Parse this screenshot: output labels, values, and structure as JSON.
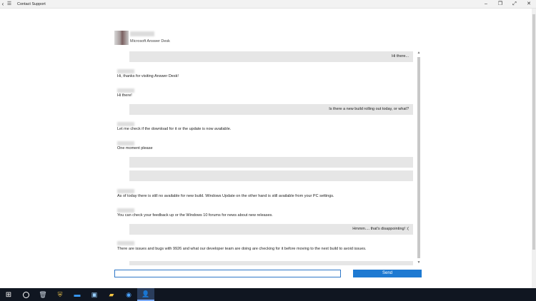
{
  "window": {
    "title": "Contact Support",
    "back_icon": "back-arrow-icon",
    "menu_icon": "hamburger-icon",
    "controls": [
      "minimize-icon",
      "restore-icon",
      "fullscreen-icon",
      "close-icon"
    ]
  },
  "header": {
    "subtitle": "Microsoft Answer Desk"
  },
  "messages": [
    {
      "from": "user",
      "text": "Hi there..."
    },
    {
      "from": "agent",
      "text": "Hi, thanks for visiting Answer Desk!"
    },
    {
      "from": "agent",
      "text": "Hi there!"
    },
    {
      "from": "user",
      "text": "Is there a new build rolling out today, or what?"
    },
    {
      "from": "agent",
      "text": "Let me check if the download for it or the update is now available."
    },
    {
      "from": "agent",
      "text": "One moment please"
    },
    {
      "from": "user",
      "text": ""
    },
    {
      "from": "user",
      "text": ""
    },
    {
      "from": "agent",
      "text": "As of today there is still no available for new build. Windows Update on the other hand is still available from your PC settings."
    },
    {
      "from": "agent",
      "text": "You can check your feedback up or the Windows 10 forums for news about new releases."
    },
    {
      "from": "user",
      "text": "Hmmm.... that's disappointing! :("
    },
    {
      "from": "agent",
      "text": "There are issues and bugs with 9926 and what our developer team are doing are checking for it before moving to the next build to avoid issues."
    }
  ],
  "composer": {
    "value": "",
    "send_label": "Send"
  },
  "taskbar": {
    "icons": [
      "windows-start-icon",
      "cortana-search-icon",
      "recycle-bin-icon",
      "windows-defender-icon",
      "messaging-icon",
      "remote-desktop-icon",
      "file-explorer-icon",
      "browser-icon",
      "contact-support-icon"
    ]
  },
  "colors": {
    "accent": "#1e7ad2",
    "bubble": "#e6e6e6",
    "taskbar": "#101621"
  }
}
